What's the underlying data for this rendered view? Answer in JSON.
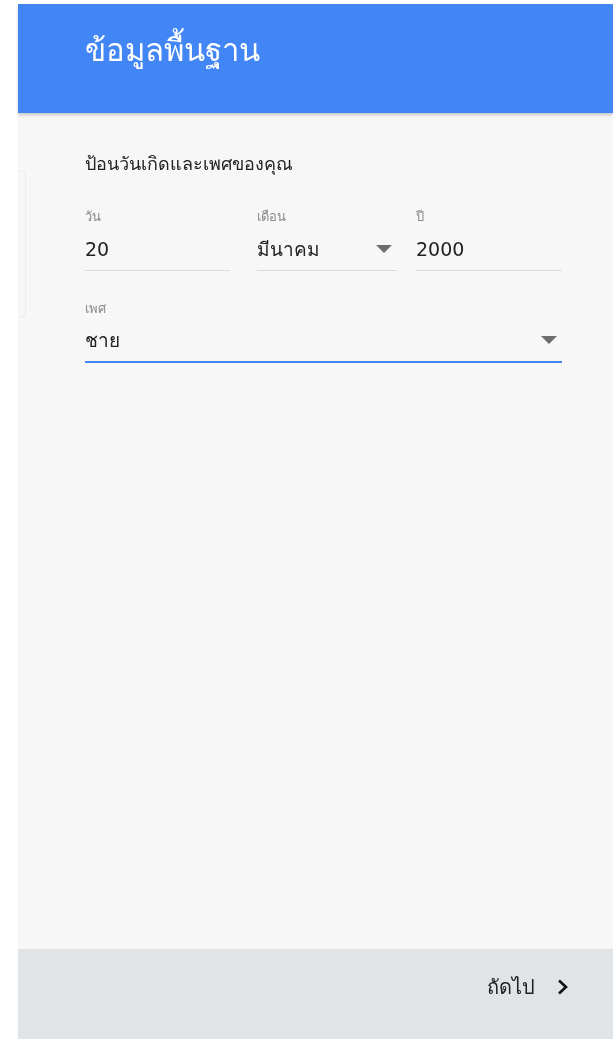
{
  "header": {
    "title": "ข้อมูลพื้นฐาน"
  },
  "prompt": "ป้อนวันเกิดและเพศของคุณ",
  "date_fields": [
    {
      "kind": "input",
      "label": "วัน",
      "value": "20",
      "focused": false
    },
    {
      "kind": "select",
      "label": "เดือน",
      "value": "มีนาคม",
      "focused": false
    },
    {
      "kind": "input",
      "label": "ปี",
      "value": "2000",
      "focused": false
    }
  ],
  "gender_field": {
    "kind": "select",
    "label": "เพศ",
    "value": "ชาย",
    "focused": true
  },
  "footer": {
    "next_button": "ถัดไป"
  }
}
